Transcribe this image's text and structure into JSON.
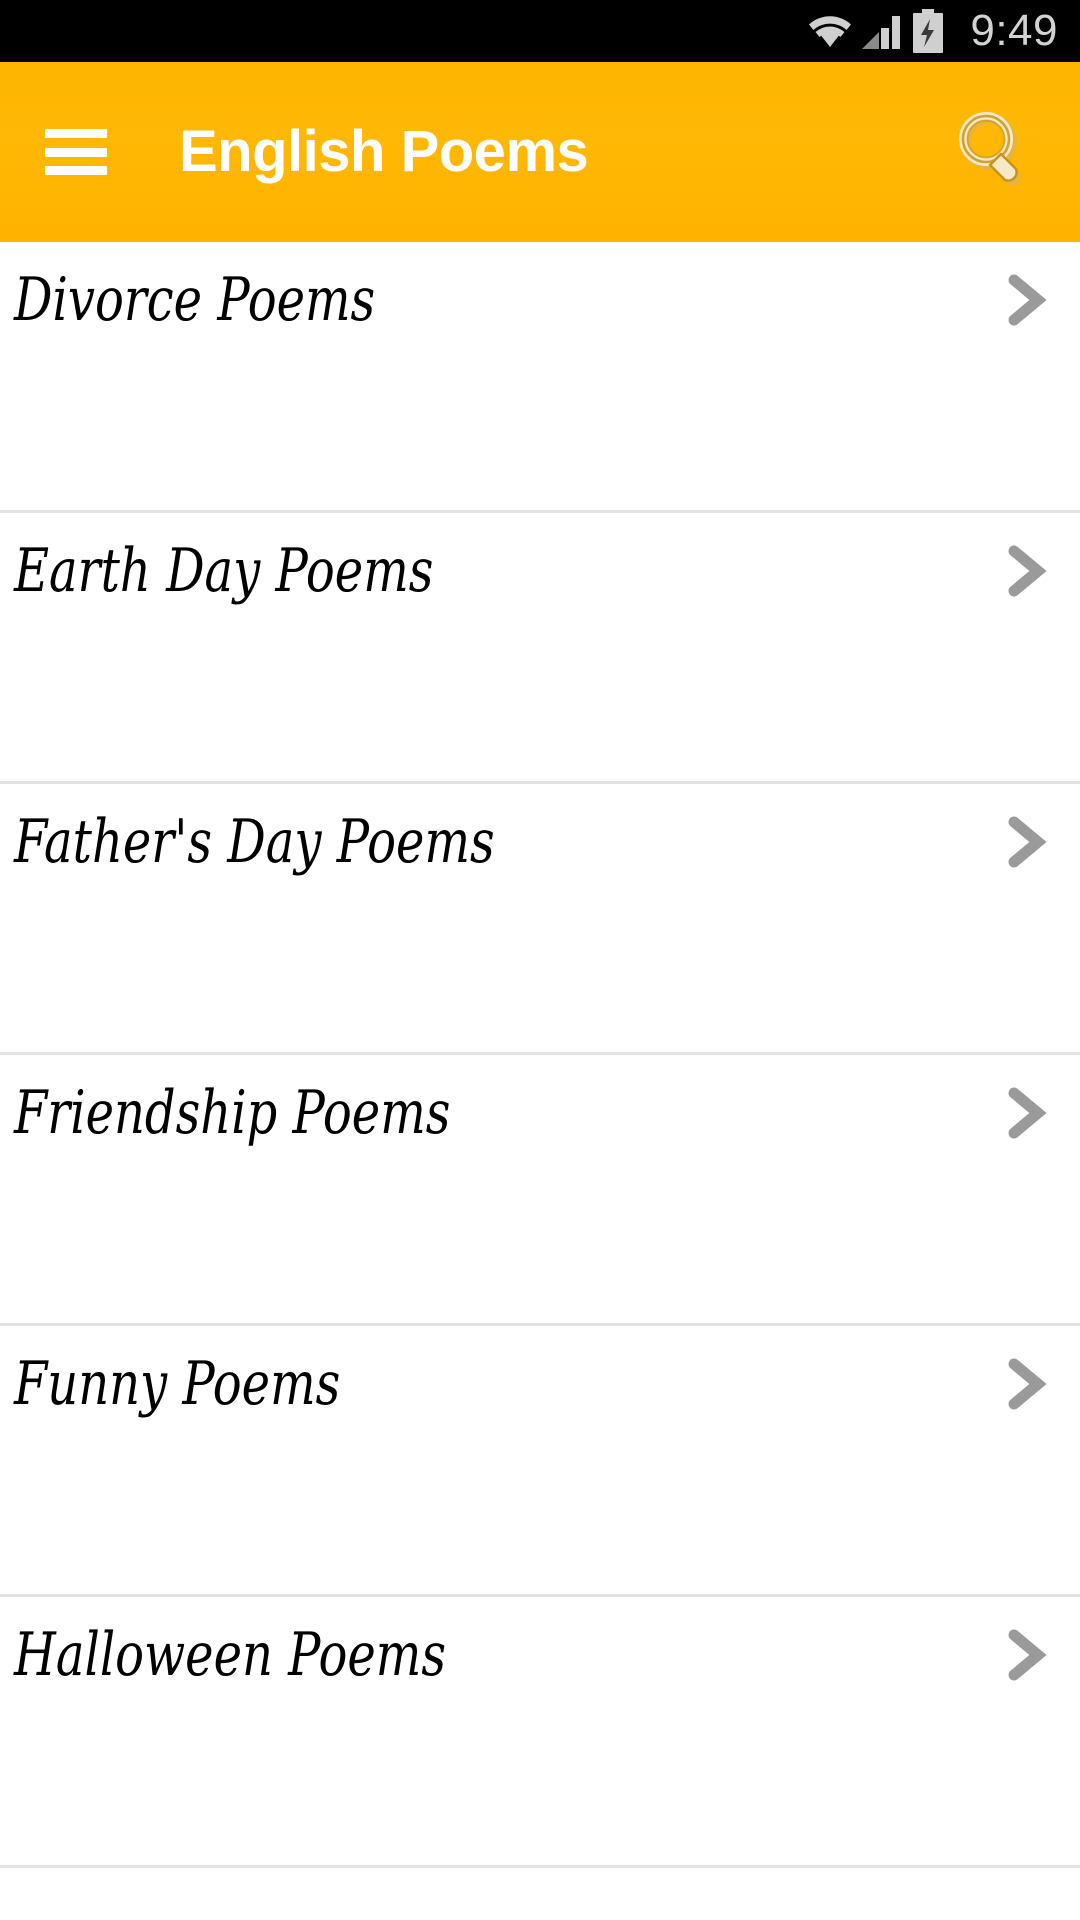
{
  "status_bar": {
    "time": "9:49",
    "icons": [
      "wifi-icon",
      "cellular-signal-icon",
      "battery-charging-icon"
    ],
    "background_color": "#000000",
    "text_color": "#d2d2d2"
  },
  "app_bar": {
    "title": "English Poems",
    "menu_icon": "hamburger-menu-icon",
    "search_icon": "search-icon",
    "background_color": "#FFB300",
    "title_color": "#FFFFFF",
    "search_icon_fill": "#F6E9C6",
    "search_icon_stroke": "#C9921C"
  },
  "list": {
    "chevron_icon": "chevron-right-icon",
    "chevron_color": "#999999",
    "divider_color": "#E3E3E3",
    "items": [
      {
        "label": "Divorce Poems"
      },
      {
        "label": "Earth Day Poems"
      },
      {
        "label": "Father's Day Poems"
      },
      {
        "label": "Friendship Poems"
      },
      {
        "label": "Funny Poems"
      },
      {
        "label": "Halloween Poems"
      }
    ]
  }
}
